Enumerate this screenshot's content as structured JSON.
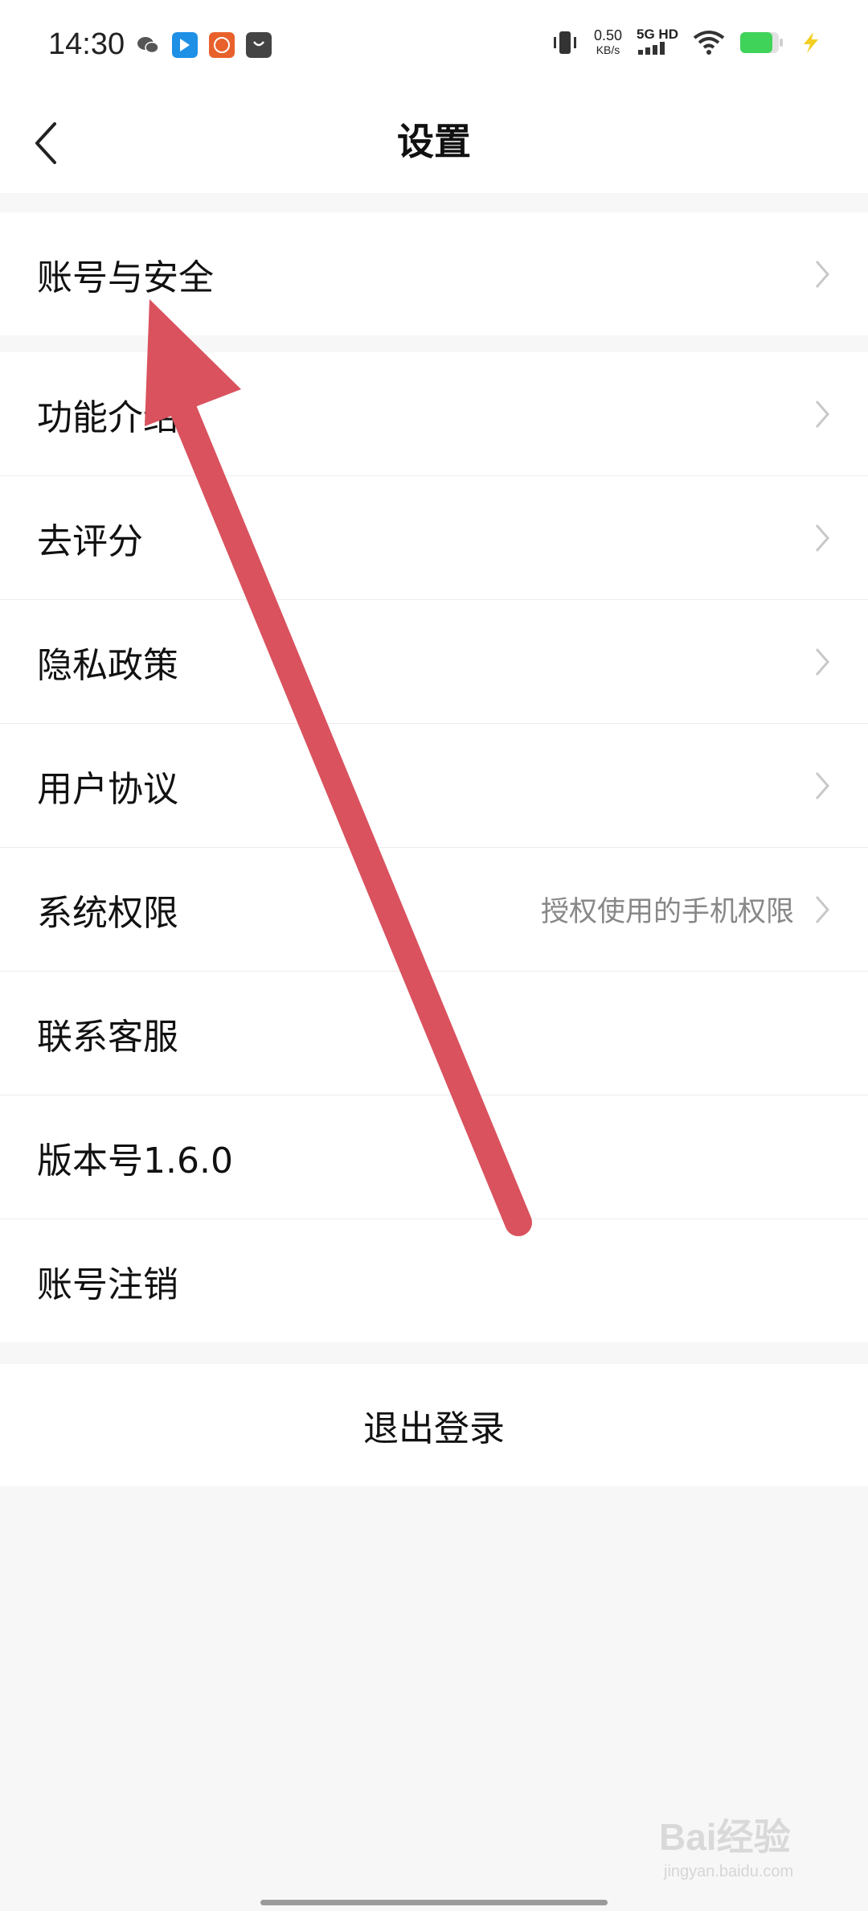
{
  "status_bar": {
    "time": "14:30",
    "net_speed_value": "0.50",
    "net_speed_unit": "KB/s",
    "network_label": "5G HD",
    "icons": [
      "wechat-icon",
      "arrow-app-icon",
      "taobao-icon",
      "shopping-bag-icon",
      "vibrate-icon",
      "signal-icon",
      "wifi-icon",
      "battery-icon",
      "charging-icon"
    ]
  },
  "nav": {
    "title": "设置",
    "back_icon": "chevron-left-icon"
  },
  "groups": [
    {
      "items": [
        {
          "label": "账号与安全",
          "value": "",
          "chevron": true
        }
      ]
    },
    {
      "items": [
        {
          "label": "功能介绍",
          "value": "",
          "chevron": true
        },
        {
          "label": "去评分",
          "value": "",
          "chevron": true
        },
        {
          "label": "隐私政策",
          "value": "",
          "chevron": true
        },
        {
          "label": "用户协议",
          "value": "",
          "chevron": true
        },
        {
          "label": "系统权限",
          "value": "授权使用的手机权限",
          "chevron": true
        },
        {
          "label": "联系客服",
          "value": "",
          "chevron": false
        },
        {
          "label": "版本号1.6.0",
          "value": "",
          "chevron": false
        },
        {
          "label": "账号注销",
          "value": "",
          "chevron": false
        }
      ]
    }
  ],
  "logout": {
    "label": "退出登录"
  },
  "watermark": {
    "text": "Bai经验",
    "sub": "jingyan.baidu.com"
  },
  "colors": {
    "arrow": "#d9525e",
    "battery": "#3fd35a",
    "chevron": "#c8c8c8",
    "background": "#f7f7f7"
  }
}
